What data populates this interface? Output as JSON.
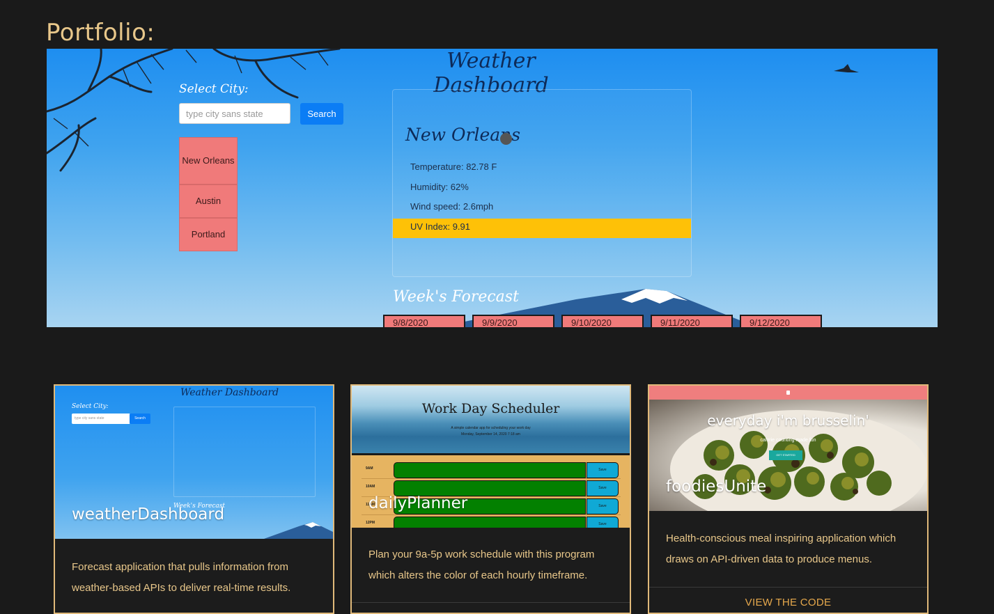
{
  "page": {
    "title": "Portfolio:"
  },
  "hero": {
    "app_title": "Weather Dashboard",
    "select_label": "Select City:",
    "search_placeholder": "type city sans state",
    "search_button": "Search",
    "history": [
      "New Orleans",
      "Austin",
      "Portland"
    ],
    "current": {
      "city": "New Orleans",
      "temperature": "Temperature: 82.78 F",
      "humidity": "Humidity: 62%",
      "wind": "Wind speed: 2.6mph",
      "uv": "UV Index: 9.91"
    },
    "forecast_title": "Week's Forecast",
    "forecast_days": [
      "9/8/2020",
      "9/9/2020",
      "9/10/2020",
      "9/11/2020",
      "9/12/2020"
    ],
    "colors": {
      "uv_bar": "#fec107",
      "history_bg": "#f07a7a",
      "search_button": "#0b7df5"
    }
  },
  "projects": [
    {
      "title": "weatherDashboard",
      "description": "Forecast application that pulls information from weather-based APIs to deliver real-time results.",
      "thumbnail": {
        "title": "Weather Dashboard",
        "select_label": "Select City:",
        "input_placeholder": "type city sans state",
        "button": "Search",
        "forecast_label": "Week's Forecast"
      }
    },
    {
      "title": "dailyPlanner",
      "description": "Plan your 9a-5p work schedule with this program which alters the color of each hourly timeframe.",
      "thumbnail": {
        "title": "Work Day Scheduler",
        "subtitle": "A simple calendar app for scheduling your work day",
        "date": "Monday, September 14, 2020 7:18 am",
        "hours": [
          "9AM",
          "10AM",
          "11AM",
          "12PM"
        ],
        "save_label": "Save"
      }
    },
    {
      "title": "foodiesUnite",
      "description": "Health-conscious meal inspiring application which draws on API-driven data to produce menus.",
      "link": "VIEW THE CODE",
      "thumbnail": {
        "tagline": "everyday i'm brusselin'",
        "small_text": "calorie counting made fun",
        "button": "GET STARTED"
      }
    }
  ],
  "colors": {
    "page_bg": "#1a1a1a",
    "accent_text": "#e8c78a",
    "card_border": "#e0b97a",
    "link": "#e6a84c"
  }
}
